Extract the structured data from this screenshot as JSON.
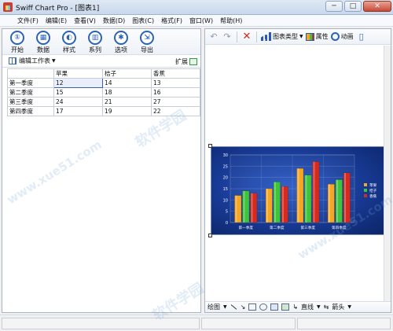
{
  "window": {
    "title": "Swiff Chart Pro - [图表1]",
    "minimize": "─",
    "maximize": "□",
    "close": "✕"
  },
  "menu": [
    "文件(F)",
    "编辑(E)",
    "查看(V)",
    "数据(D)",
    "图表(C)",
    "格式(F)",
    "窗口(W)",
    "帮助(H)"
  ],
  "left_toolbar": [
    {
      "label": "开始",
      "glyph": "①"
    },
    {
      "label": "数据",
      "glyph": "▦"
    },
    {
      "label": "样式",
      "glyph": "◐"
    },
    {
      "label": "系列",
      "glyph": "▥"
    },
    {
      "label": "选项",
      "glyph": "✱"
    },
    {
      "label": "导出",
      "glyph": "⇲"
    }
  ],
  "worksheet": {
    "label": "编辑工作表",
    "expand_label": "扩展",
    "columns": [
      "",
      "苹果",
      "桔子",
      "香蕉"
    ],
    "rows": [
      [
        "第一季度",
        "12",
        "14",
        "13"
      ],
      [
        "第二季度",
        "15",
        "18",
        "16"
      ],
      [
        "第三季度",
        "24",
        "21",
        "27"
      ],
      [
        "第四季度",
        "17",
        "19",
        "22"
      ]
    ]
  },
  "right_toolbar": {
    "chart_type_label": "图表类型",
    "properties_label": "属性",
    "animation_label": "动画"
  },
  "draw_toolbar": {
    "draw_label": "绘图",
    "line_label": "直线",
    "arrow_label": "箭头"
  },
  "chart_data": {
    "type": "bar",
    "categories": [
      "第一季度",
      "第二季度",
      "第三季度",
      "第四季度"
    ],
    "series": [
      {
        "name": "苹果",
        "color": "#f5a623",
        "values": [
          12,
          15,
          24,
          17
        ]
      },
      {
        "name": "桔子",
        "color": "#3ec43a",
        "values": [
          14,
          18,
          21,
          19
        ]
      },
      {
        "name": "香蕉",
        "color": "#d62a1e",
        "values": [
          13,
          16,
          27,
          22
        ]
      }
    ],
    "yticks": [
      "0",
      "5",
      "10",
      "15",
      "20",
      "25",
      "30"
    ],
    "ylim": [
      0,
      30
    ],
    "grid": true,
    "legend": "right"
  },
  "watermark": {
    "text1": "软件学园",
    "text2": "www.xue51.com"
  },
  "colors": {
    "accent": "#2b63b8",
    "chart_bg": "#173a94"
  }
}
